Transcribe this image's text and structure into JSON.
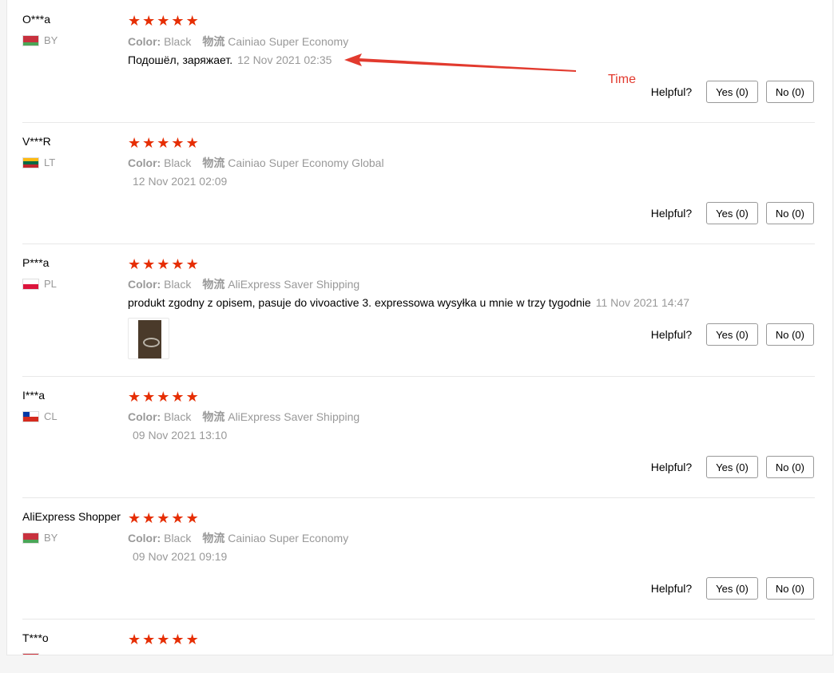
{
  "labels": {
    "color": "Color:",
    "shipping": "物流",
    "helpful": "Helpful?"
  },
  "annotation": {
    "text": "Time",
    "color": "#e23a2e"
  },
  "accent": "#e62e04",
  "reviews": [
    {
      "name": "O***a",
      "country": "BY",
      "flag": "belarus",
      "rating": 5,
      "color": "Black",
      "shipping": "Cainiao Super Economy",
      "text": "Подошёл, заряжает.",
      "date": "12 Nov 2021 02:35",
      "yes": "Yes (0)",
      "no": "No (0)"
    },
    {
      "name": "V***R",
      "country": "LT",
      "flag": "lithuania",
      "rating": 5,
      "color": "Black",
      "shipping": "Cainiao Super Economy Global",
      "text": "",
      "date": "12 Nov 2021 02:09",
      "yes": "Yes (0)",
      "no": "No (0)"
    },
    {
      "name": "P***a",
      "country": "PL",
      "flag": "poland",
      "rating": 5,
      "color": "Black",
      "shipping": "AliExpress Saver Shipping",
      "text": "produkt zgodny z opisem, pasuje do vivoactive 3. expressowa wysyłka u mnie w trzy tygodnie",
      "date": "11 Nov 2021 14:47",
      "yes": "Yes (0)",
      "no": "No (0)",
      "has_photo": true
    },
    {
      "name": "I***a",
      "country": "CL",
      "flag": "chile",
      "rating": 5,
      "color": "Black",
      "shipping": "AliExpress Saver Shipping",
      "text": "",
      "date": "09 Nov 2021 13:10",
      "yes": "Yes (0)",
      "no": "No (0)"
    },
    {
      "name": "AliExpress Shopper",
      "country": "BY",
      "flag": "belarus",
      "rating": 5,
      "color": "Black",
      "shipping": "Cainiao Super Economy",
      "text": "",
      "date": "09 Nov 2021 09:19",
      "yes": "Yes (0)",
      "no": "No (0)"
    },
    {
      "name": "T***o",
      "rating": 5
    }
  ]
}
